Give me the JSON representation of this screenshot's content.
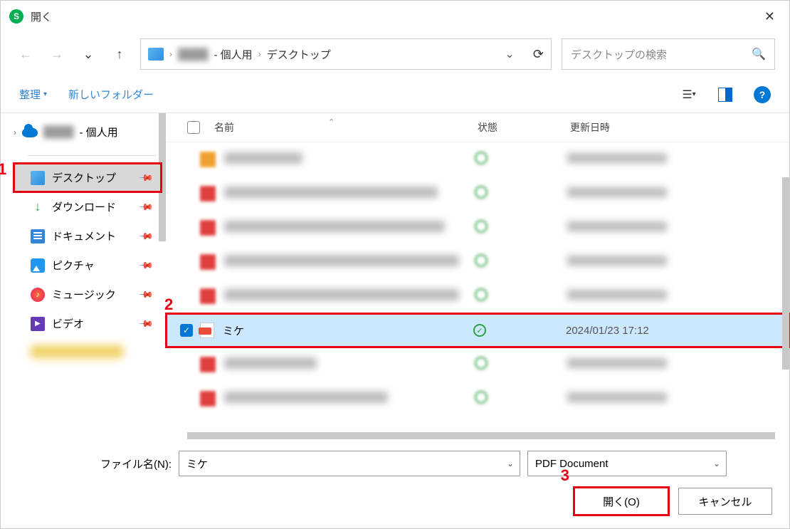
{
  "window": {
    "title": "開く"
  },
  "nav": {
    "breadcrumb": {
      "user_segment": "████",
      "personal": "- 個人用",
      "location": "デスクトップ"
    }
  },
  "search": {
    "placeholder": "デスクトップの検索"
  },
  "toolbar": {
    "organize": "整理",
    "new_folder": "新しいフォルダー"
  },
  "tree": {
    "root_suffix": "- 個人用",
    "quick_access": [
      {
        "label": "デスクトップ"
      },
      {
        "label": "ダウンロード"
      },
      {
        "label": "ドキュメント"
      },
      {
        "label": "ピクチャ"
      },
      {
        "label": "ミュージック"
      },
      {
        "label": "ビデオ"
      }
    ]
  },
  "list": {
    "headers": {
      "name": "名前",
      "state": "状態",
      "modified": "更新日時"
    },
    "selected": {
      "name": "ミケ",
      "modified": "2024/01/23 17:12"
    }
  },
  "footer": {
    "filename_label": "ファイル名(N):",
    "filename_value": "ミケ",
    "filter_value": "PDF Document",
    "open_button": "開く(O)",
    "cancel_button": "キャンセル"
  },
  "markers": {
    "m1": "1",
    "m2": "2",
    "m3": "3"
  }
}
